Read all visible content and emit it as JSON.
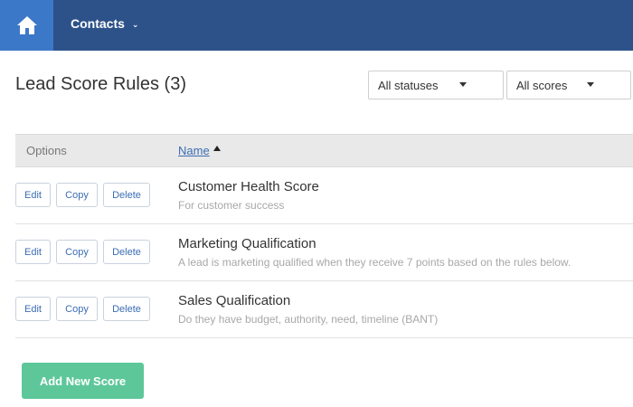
{
  "nav": {
    "home_icon": "home-icon",
    "contacts_label": "Contacts",
    "colors": {
      "bar": "#2d5289",
      "home": "#3c78c8"
    }
  },
  "page": {
    "title": "Lead Score Rules (3)"
  },
  "filters": {
    "status_value": "All statuses",
    "score_value": "All scores"
  },
  "table": {
    "columns": {
      "options": "Options",
      "name": "Name"
    },
    "rows": [
      {
        "name": "Customer Health Score",
        "description": "For customer success",
        "edit": "Edit",
        "copy": "Copy",
        "delete": "Delete"
      },
      {
        "name": "Marketing Qualification",
        "description": "A lead is marketing qualified when they receive 7 points based on the rules below.",
        "edit": "Edit",
        "copy": "Copy",
        "delete": "Delete"
      },
      {
        "name": "Sales Qualification",
        "description": "Do they have budget, authority, need, timeline (BANT)",
        "edit": "Edit",
        "copy": "Copy",
        "delete": "Delete"
      }
    ]
  },
  "actions": {
    "add_label": "Add New Score",
    "add_color": "#5dc79a"
  }
}
